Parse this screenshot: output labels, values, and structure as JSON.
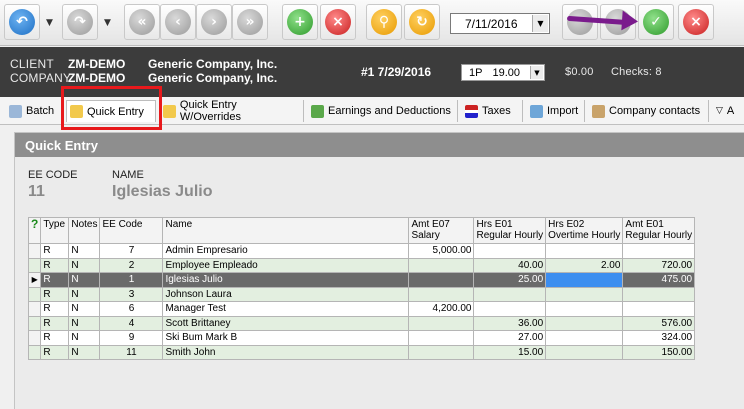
{
  "toolbar": {
    "date_value": "7/11/2016",
    "buttons": [
      {
        "name": "back-button",
        "icon": "back-arrow-icon"
      },
      {
        "name": "forward-button",
        "icon": "forward-arrow-icon"
      },
      {
        "name": "first-record-button",
        "icon": "first-icon"
      },
      {
        "name": "previous-record-button",
        "icon": "previous-icon"
      },
      {
        "name": "next-record-button",
        "icon": "next-icon"
      },
      {
        "name": "last-record-button",
        "icon": "last-icon"
      },
      {
        "name": "add-employee-button",
        "icon": "add-person-icon"
      },
      {
        "name": "remove-employee-button",
        "icon": "remove-person-icon"
      },
      {
        "name": "search-button",
        "icon": "search-icon"
      },
      {
        "name": "refresh-button",
        "icon": "refresh-icon"
      },
      {
        "name": "save-button",
        "icon": "database-save-icon"
      },
      {
        "name": "cancel-button",
        "icon": "database-cancel-icon"
      }
    ]
  },
  "header": {
    "client_label": "CLIENT",
    "client_code": "ZM-DEMO",
    "client_name": "Generic Company, Inc.",
    "company_label": "COMPANY",
    "company_code": "ZM-DEMO",
    "company_name": "Generic Company, Inc.",
    "batch": "#1 7/29/2016",
    "period_code": "1P",
    "period_hours": "19.00",
    "amount": "$0.00",
    "checks": "Checks: 8"
  },
  "tabs": [
    {
      "label": "Batch"
    },
    {
      "label": "Quick Entry"
    },
    {
      "label": "Quick Entry W/Overrides"
    },
    {
      "label": "Earnings and Deductions"
    },
    {
      "label": "Taxes"
    },
    {
      "label": "Import"
    },
    {
      "label": "Company contacts"
    },
    {
      "label": "A"
    }
  ],
  "panel": {
    "title": "Quick Entry",
    "ee_code_label": "EE CODE",
    "ee_code_value": "11",
    "name_label": "NAME",
    "name_value": "Iglesias Julio"
  },
  "grid": {
    "headers": {
      "check": "?",
      "type": "Type",
      "notes": "Notes",
      "ee_code": "EE Code",
      "name": "Name",
      "amt_e07_1": "Amt E07",
      "amt_e07_2": "Salary",
      "hrs_e01_1": "Hrs E01",
      "hrs_e01_2": "Regular Hourly",
      "hrs_e02_1": "Hrs E02",
      "hrs_e02_2": "Overtime Hourly",
      "amt_e01_1": "Amt E01",
      "amt_e01_2": "Regular Hourly"
    },
    "rows": [
      {
        "type": "R",
        "notes": "N",
        "code": "7",
        "name": "Admin Empresario",
        "amt_e07": "5,000.00",
        "hrs_e01": "",
        "hrs_e02": "",
        "amt_e01": ""
      },
      {
        "type": "R",
        "notes": "N",
        "code": "2",
        "name": "Employee Empleado",
        "amt_e07": "",
        "hrs_e01": "40.00",
        "hrs_e02": "2.00",
        "amt_e01": "720.00"
      },
      {
        "type": "R",
        "notes": "N",
        "code": "1",
        "name": "Iglesias Julio",
        "amt_e07": "",
        "hrs_e01": "25.00",
        "hrs_e02": "",
        "amt_e01": "475.00"
      },
      {
        "type": "R",
        "notes": "N",
        "code": "3",
        "name": "Johnson Laura",
        "amt_e07": "",
        "hrs_e01": "",
        "hrs_e02": "",
        "amt_e01": ""
      },
      {
        "type": "R",
        "notes": "N",
        "code": "6",
        "name": "Manager Test",
        "amt_e07": "4,200.00",
        "hrs_e01": "",
        "hrs_e02": "",
        "amt_e01": ""
      },
      {
        "type": "R",
        "notes": "N",
        "code": "4",
        "name": "Scott Brittaney",
        "amt_e07": "",
        "hrs_e01": "36.00",
        "hrs_e02": "",
        "amt_e01": "576.00"
      },
      {
        "type": "R",
        "notes": "N",
        "code": "9",
        "name": "Ski Bum Mark B",
        "amt_e07": "",
        "hrs_e01": "27.00",
        "hrs_e02": "",
        "amt_e01": "324.00"
      },
      {
        "type": "R",
        "notes": "N",
        "code": "11",
        "name": "Smith John",
        "amt_e07": "",
        "hrs_e01": "15.00",
        "hrs_e02": "",
        "amt_e01": "150.00"
      }
    ]
  }
}
